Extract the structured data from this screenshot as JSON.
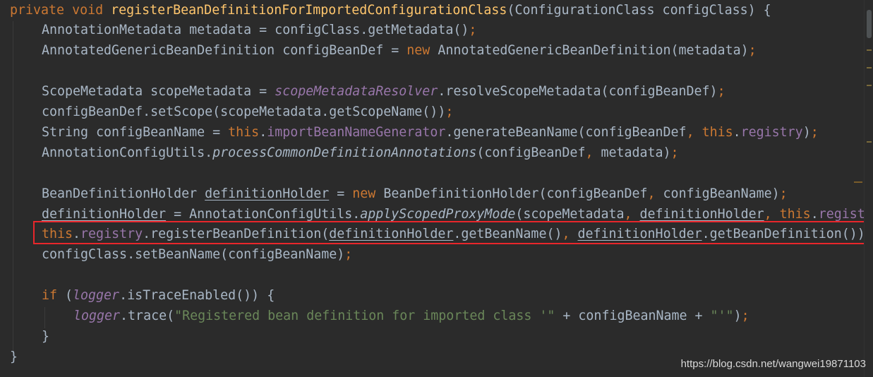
{
  "code": {
    "l1": {
      "k1": "private",
      "k2": "void",
      "method": "registerBeanDefinitionForImportedConfigurationClass",
      "rest": "(ConfigurationClass configClass) {"
    },
    "l2": {
      "a": "AnnotationMetadata metadata = configClass.getMetadata()",
      "semi": ";"
    },
    "l3": {
      "a": "AnnotatedGenericBeanDefinition configBeanDef = ",
      "kw": "new",
      "b": " AnnotatedGenericBeanDefinition(metadata)",
      "semi": ";"
    },
    "l5": {
      "a": "ScopeMetadata scopeMetadata = ",
      "field": "scopeMetadataResolver",
      "b": ".resolveScopeMetadata(configBeanDef)",
      "semi": ";"
    },
    "l6": {
      "a": "configBeanDef.setScope(scopeMetadata.getScopeName())",
      "semi": ";"
    },
    "l7": {
      "a": "String configBeanName = ",
      "this1": "this",
      "dot1": ".",
      "field1": "importBeanNameGenerator",
      "b": ".generateBeanName(configBeanDef",
      "comma": ",",
      "sp": " ",
      "this2": "this",
      "dot2": ".",
      "field2": "registry",
      "c": ")",
      "semi": ";"
    },
    "l8": {
      "a": "AnnotationConfigUtils.",
      "static": "processCommonDefinitionAnnotations",
      "b": "(configBeanDef",
      "comma": ",",
      "c": " metadata)",
      "semi": ";"
    },
    "l10": {
      "a": "BeanDefinitionHolder ",
      "var": "definitionHolder",
      "b": " = ",
      "kw": "new",
      "c": " BeanDefinitionHolder(configBeanDef",
      "comma": ",",
      "d": " configBeanName)",
      "semi": ";"
    },
    "l11": {
      "var": "definitionHolder",
      "a": " = AnnotationConfigUtils.",
      "static": "applyScopedProxyMode",
      "b": "(scopeMetadata",
      "comma1": ",",
      "sp": " ",
      "var2": "definitionHolder",
      "comma2": ",",
      "sp2": " ",
      "this": "this",
      "dot": ".",
      "field": "regist"
    },
    "l12": {
      "this": "this",
      "dot": ".",
      "field": "registry",
      "a": ".registerBeanDefinition(",
      "var1": "definitionHolder",
      "b": ".getBeanName()",
      "comma": ",",
      "sp": " ",
      "var2": "definitionHolder",
      "c": ".getBeanDefinition())"
    },
    "l13": {
      "a": "configClass.setBeanName(configBeanName)",
      "semi": ";"
    },
    "l15": {
      "kw": "if",
      "a": " (",
      "field": "logger",
      "b": ".isTraceEnabled()) {"
    },
    "l16": {
      "field": "logger",
      "a": ".trace(",
      "str1": "\"Registered bean definition for imported class '\"",
      "b": " + configBeanName + ",
      "str2": "\"'\"",
      "c": ")",
      "semi": ";"
    },
    "l17": {
      "a": "}"
    },
    "l18": {
      "a": "}"
    }
  },
  "watermark": "https://blog.csdn.net/wangwei19871103",
  "colors": {
    "background": "#2b2b2b",
    "text": "#a9b7c6",
    "keyword": "#cc7832",
    "method_decl": "#ffc66d",
    "field": "#9876aa",
    "string": "#6a8759",
    "highlight": "#e8262b"
  }
}
